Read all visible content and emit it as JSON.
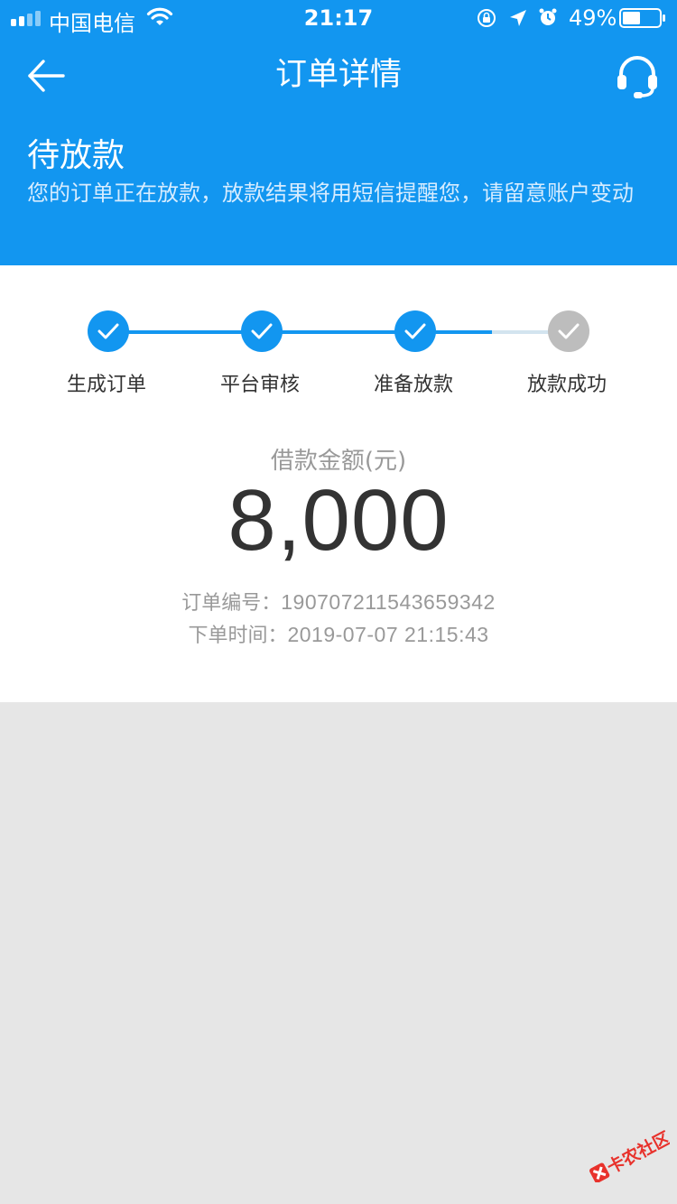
{
  "status_bar": {
    "carrier": "中国电信",
    "time": "21:17",
    "battery_percent": "49%",
    "battery_level": 0.49
  },
  "nav": {
    "title": "订单详情"
  },
  "order_status": {
    "title": "待放款",
    "description": "您的订单正在放款，放款结果将用短信提醒您，请留意账户变动"
  },
  "progress": {
    "steps": [
      {
        "label": "生成订单",
        "done": true
      },
      {
        "label": "平台审核",
        "done": true
      },
      {
        "label": "准备放款",
        "done": true
      },
      {
        "label": "放款成功",
        "done": false
      }
    ]
  },
  "loan": {
    "amount_label": "借款金额(元)",
    "amount": "8,000"
  },
  "order_info": {
    "number_label": "订单编号：",
    "number": "190707211543659342",
    "time_label": "下单时间：",
    "time": "2019-07-07 21:15:43"
  },
  "watermark": {
    "text": "卡农社区"
  },
  "colors": {
    "primary": "#1296f0",
    "done_step": "#1296f0",
    "pending_step": "#bdbdbd",
    "pending_line": "#d3e4ef",
    "background": "#e6e6e6",
    "watermark_red": "#e8322c"
  }
}
